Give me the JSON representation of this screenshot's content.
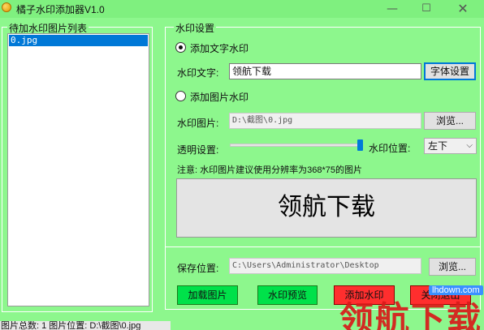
{
  "window": {
    "title": "橘子水印添加器V1.0",
    "minimize_glyph": "—",
    "maximize_glyph": "☐",
    "close_glyph": "✕"
  },
  "left_panel": {
    "group_label": "待加水印图片列表",
    "items": [
      "0.jpg"
    ]
  },
  "settings": {
    "group_label": "水印设置",
    "text_mode_label": "添加文字水印",
    "text_mode_checked": true,
    "watermark_text_label": "水印文字:",
    "watermark_text_value": "领航下载",
    "font_button_label": "字体设置",
    "image_mode_label": "添加图片水印",
    "image_mode_checked": false,
    "watermark_image_label": "水印图片:",
    "watermark_image_value": "D:\\截图\\0.jpg",
    "browse_image_label": "浏览...",
    "opacity_label": "透明设置:",
    "opacity_value": 1.0,
    "position_label": "水印位置:",
    "position_value": "左下",
    "note": "注意: 水印图片建议使用分辨率为368*75的图片",
    "preview_text": "领航下载"
  },
  "output": {
    "save_label": "保存位置:",
    "save_value": "C:\\Users\\Administrator\\Desktop",
    "browse_save_label": "浏览..."
  },
  "actions": {
    "load_label": "加载图片",
    "preview_label": "水印预览",
    "add_label": "添加水印",
    "close_label": "关闭退出"
  },
  "status": {
    "text": "图片总数: 1  图片位置: D:\\截图\\0.jpg"
  },
  "overlay": {
    "site_watermark": "领航下载",
    "site_url": "lhdown.com"
  },
  "colors": {
    "window_bg": "#8df78d",
    "green_button": "#00e14a",
    "red_button": "#ff2e2e",
    "selection": "#0078d7",
    "watermark_red": "#d81a1a"
  }
}
